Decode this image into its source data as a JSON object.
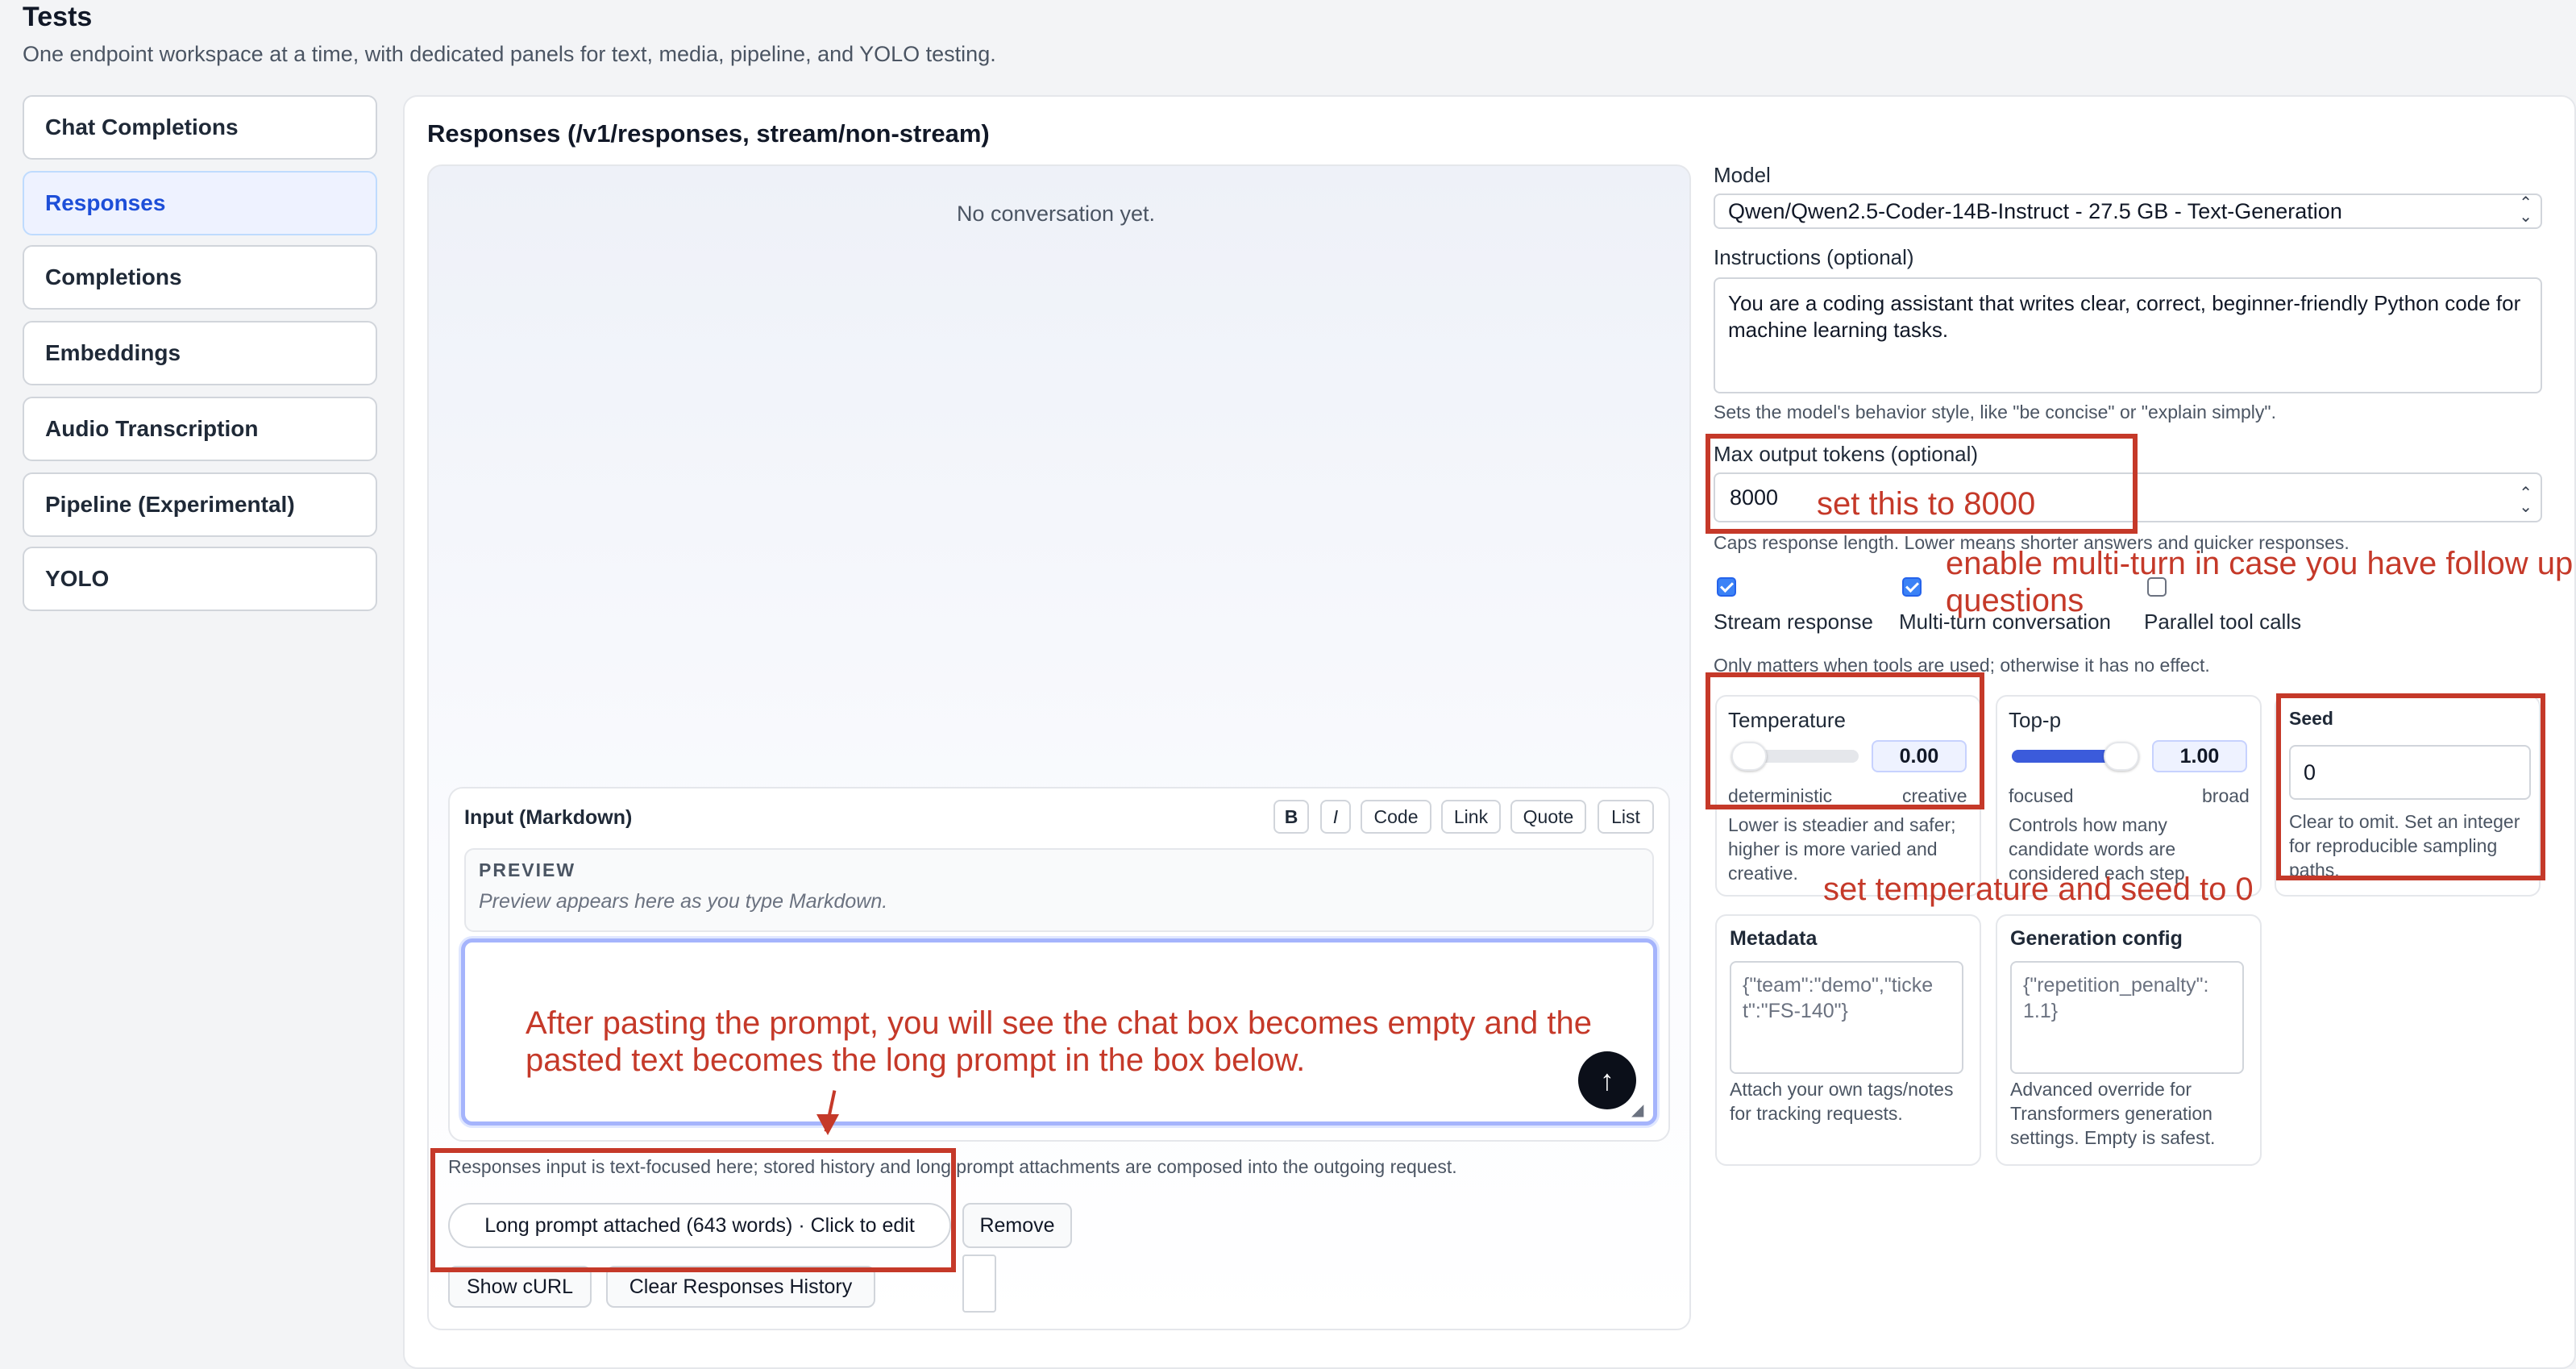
{
  "page": {
    "title": "Tests",
    "subtitle": "One endpoint workspace at a time, with dedicated panels for text, media, pipeline, and YOLO testing."
  },
  "sidebar": {
    "items": [
      {
        "label": "Chat Completions",
        "active": false
      },
      {
        "label": "Responses",
        "active": true
      },
      {
        "label": "Completions",
        "active": false
      },
      {
        "label": "Embeddings",
        "active": false
      },
      {
        "label": "Audio Transcription",
        "active": false
      },
      {
        "label": "Pipeline (Experimental)",
        "active": false
      },
      {
        "label": "YOLO",
        "active": false
      }
    ]
  },
  "main": {
    "section_title": "Responses (/v1/responses, stream/non-stream)",
    "conversation_empty": "No conversation yet.",
    "input": {
      "label": "Input (Markdown)",
      "format_buttons": [
        "B",
        "I",
        "Code",
        "Link",
        "Quote",
        "List"
      ],
      "preview_label": "PREVIEW",
      "preview_placeholder": "Preview appears here as you type Markdown.",
      "value": ""
    },
    "note": "Responses input is text-focused here; stored history and long prompt attachments are composed into the outgoing request.",
    "long_prompt_button": "Long prompt attached (643 words) · Click to edit",
    "remove_button": "Remove",
    "show_curl_button": "Show cURL",
    "clear_history_button": "Clear Responses History"
  },
  "settings": {
    "model": {
      "label": "Model",
      "value": "Qwen/Qwen2.5-Coder-14B-Instruct - 27.5 GB - Text-Generation"
    },
    "instructions": {
      "label": "Instructions (optional)",
      "value": "You are a coding assistant that writes clear, correct, beginner-friendly Python code for machine learning tasks.",
      "help": "Sets the model's behavior style, like \"be concise\" or \"explain simply\"."
    },
    "max_tokens": {
      "label": "Max output tokens (optional)",
      "value": "8000",
      "help": "Caps response length. Lower means shorter answers and quicker responses."
    },
    "checkboxes": [
      {
        "label": "Stream response",
        "checked": true
      },
      {
        "label": "Multi-turn conversation",
        "checked": true
      },
      {
        "label": "Parallel tool calls",
        "checked": false
      }
    ],
    "tools_note": "Only matters when tools are used; otherwise it has no effect.",
    "temperature": {
      "label": "Temperature",
      "value": "0.00",
      "fraction": 0.0,
      "min_label": "deterministic",
      "max_label": "creative",
      "help": "Lower is steadier and safer; higher is more varied and creative."
    },
    "top_p": {
      "label": "Top-p",
      "value": "1.00",
      "fraction": 1.0,
      "min_label": "focused",
      "max_label": "broad",
      "help": "Controls how many candidate words are considered each step."
    },
    "seed": {
      "label": "Seed",
      "value": "0",
      "help": "Clear to omit. Set an integer for reproducible sampling paths."
    },
    "metadata": {
      "label": "Metadata",
      "placeholder": "{\"team\":\"demo\",\"ticket\":\"FS-140\"}",
      "help": "Attach your own tags/notes for tracking requests."
    },
    "generation_config": {
      "label": "Generation config",
      "placeholder": "{\"repetition_penalty\": 1.1}",
      "help": "Advanced override for Transformers generation settings. Empty is safest."
    }
  },
  "annotations": {
    "tokens": "set this to 8000",
    "multiturn": "enable multi-turn in case you have follow up questions",
    "temp_seed": "set temperature and seed to 0",
    "paste": "After pasting the prompt, you will see the chat box becomes empty and the pasted text becomes the long prompt in the box below."
  },
  "colors": {
    "accent": "#3b5bdb",
    "annotation": "#c53929",
    "active_nav_bg": "#eef2ff"
  }
}
